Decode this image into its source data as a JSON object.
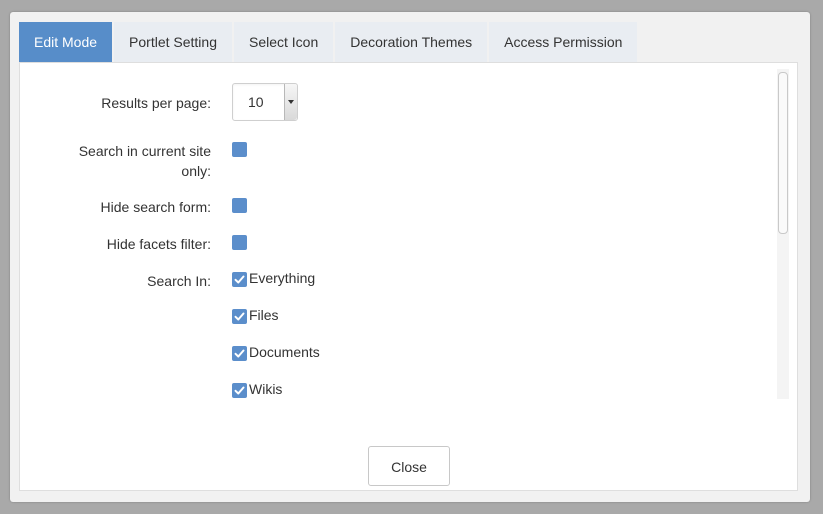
{
  "tabs": [
    {
      "label": "Edit Mode",
      "active": true
    },
    {
      "label": "Portlet Setting",
      "active": false
    },
    {
      "label": "Select Icon",
      "active": false
    },
    {
      "label": "Decoration Themes",
      "active": false
    },
    {
      "label": "Access Permission",
      "active": false
    }
  ],
  "form": {
    "results_per_page": {
      "label": "Results per page:",
      "value": "10"
    },
    "search_current_site": {
      "label_line1": "Search in current site",
      "label_line2": "only:",
      "checked": false
    },
    "hide_search_form": {
      "label": "Hide search form:",
      "checked": false
    },
    "hide_facets_filter": {
      "label": "Hide facets filter:",
      "checked": false
    },
    "search_in": {
      "label": "Search In:",
      "options": [
        {
          "label": "Everything",
          "checked": true
        },
        {
          "label": "Files",
          "checked": true
        },
        {
          "label": "Documents",
          "checked": true
        },
        {
          "label": "Wikis",
          "checked": true
        }
      ]
    }
  },
  "footer": {
    "close_label": "Close"
  },
  "colors": {
    "accent": "#578dc9",
    "checkbox": "#5b8ecb"
  }
}
